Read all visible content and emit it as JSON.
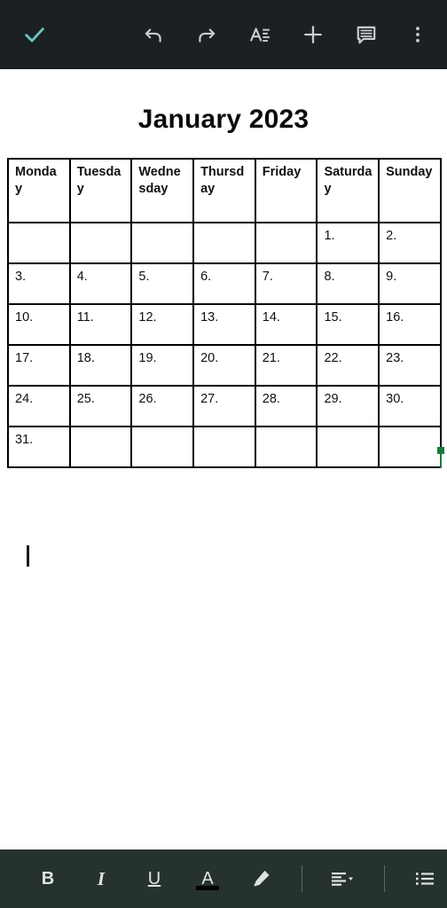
{
  "app": {
    "theme": {
      "top_toolbar_bg": "#1b2022",
      "bottom_toolbar_bg": "#263230",
      "accent_check": "#68c7c1",
      "caret_green": "#1a7a3c",
      "icon_color": "#c9cdcd",
      "text_color_swatch": "#000000"
    }
  },
  "top_toolbar": {
    "items": [
      {
        "name": "confirm-check",
        "icon": "check-icon",
        "label": "Done"
      },
      {
        "name": "undo",
        "icon": "undo-icon",
        "label": "Undo"
      },
      {
        "name": "redo",
        "icon": "redo-icon",
        "label": "Redo"
      },
      {
        "name": "text-format",
        "icon": "text-format-icon",
        "label": "Format"
      },
      {
        "name": "insert",
        "icon": "plus-icon",
        "label": "Insert"
      },
      {
        "name": "comment",
        "icon": "comment-icon",
        "label": "Comment"
      },
      {
        "name": "more-options",
        "icon": "overflow-menu-icon",
        "label": "More options"
      }
    ]
  },
  "document": {
    "title": "January 2023",
    "caret_below_table": true
  },
  "calendar": {
    "headers": [
      "Monday",
      "Tuesday",
      "Wednesday",
      "Thursday",
      "Friday",
      "Saturday",
      "Sunday"
    ],
    "editing_cell": "Sunday",
    "rows": [
      [
        "",
        "",
        "",
        "",
        "",
        "1.",
        "2."
      ],
      [
        "3.",
        "4.",
        "5.",
        "6.",
        "7.",
        "8.",
        "9."
      ],
      [
        "10.",
        "11.",
        "12.",
        "13.",
        "14.",
        "15.",
        "16."
      ],
      [
        "17.",
        "18.",
        "19.",
        "20.",
        "21.",
        "22.",
        "23."
      ],
      [
        "24.",
        "25.",
        "26.",
        "27.",
        "28.",
        "29.",
        "30."
      ],
      [
        "31.",
        "",
        "",
        "",
        "",
        "",
        ""
      ]
    ]
  },
  "bottom_toolbar": {
    "items": [
      {
        "name": "bold",
        "label": "B",
        "icon": "bold-icon"
      },
      {
        "name": "italic",
        "label": "I",
        "icon": "italic-icon"
      },
      {
        "name": "underline",
        "label": "U",
        "icon": "underline-icon"
      },
      {
        "name": "text-color",
        "label": "A",
        "icon": "text-color-icon",
        "swatch": "#000000"
      },
      {
        "name": "highlight",
        "label": "Highlight",
        "icon": "highlighter-pen-icon"
      },
      {
        "name": "align",
        "label": "Align",
        "icon": "align-left-icon"
      },
      {
        "name": "bullet-list",
        "label": "Bulleted list",
        "icon": "bullet-list-icon"
      }
    ]
  }
}
